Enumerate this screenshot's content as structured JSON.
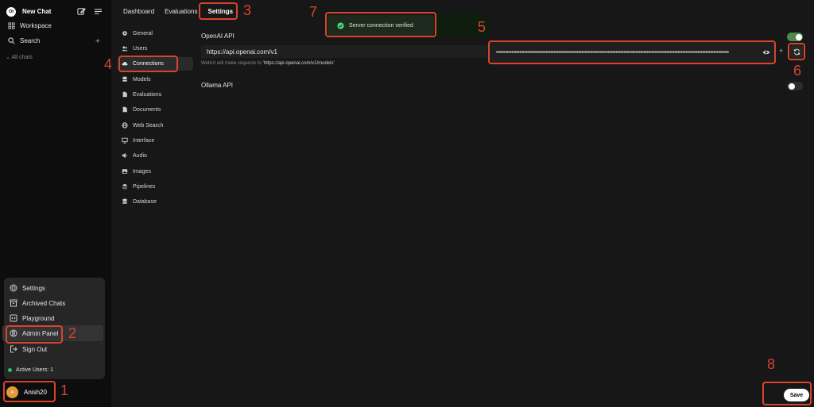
{
  "sidebar": {
    "logo": "OI",
    "new_chat": "New Chat",
    "workspace": "Workspace",
    "search": "Search",
    "all_chats": "All chats",
    "menu": [
      "Settings",
      "Archived Chats",
      "Playground",
      "Admin Panel",
      "Sign Out"
    ],
    "active_users": "Active Users: 1",
    "user": {
      "initial": "A",
      "name": "Anish20"
    }
  },
  "tabs": [
    "Dashboard",
    "Evaluations",
    "Settings"
  ],
  "settings_nav": [
    "General",
    "Users",
    "Connections",
    "Models",
    "Evaluations",
    "Documents",
    "Web Search",
    "Interface",
    "Audio",
    "Images",
    "Pipelines",
    "Database"
  ],
  "connections": {
    "openai_label": "OpenAI API",
    "url": "https://api.openai.com/v1",
    "hint_prefix": "WebUI will make requests to ",
    "hint_url": "'https://api.openai.com/v1/models'",
    "api_key_masked": "••••••••••••••••••••••••••••••••••••••••••••••••••••••••••••••••••••••••••••••••••••••••••••••••••••••••••••••••••••••••••••••••••••••••••••••••••••••",
    "openai_enabled": true,
    "ollama_label": "Ollama API",
    "ollama_enabled": false
  },
  "toast": {
    "text": "Server connection verified"
  },
  "save_label": "Save",
  "annotations": [
    "1",
    "2",
    "3",
    "4",
    "5",
    "6",
    "7",
    "8"
  ],
  "colors": {
    "accent_toggle": "#4a8a4a",
    "annotation": "#d9432e",
    "toast_bg": "#1d2a1d"
  }
}
